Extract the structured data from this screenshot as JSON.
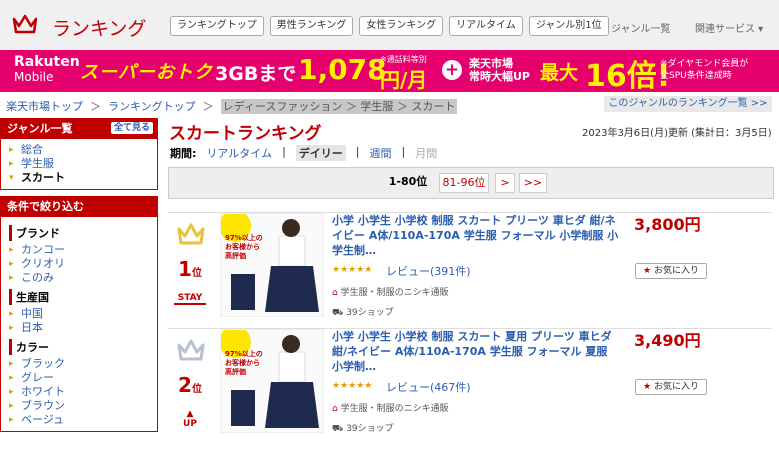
{
  "header": {
    "title": "ランキング",
    "tabs": [
      "ランキングトップ",
      "男性ランキング",
      "女性ランキング",
      "リアルタイム",
      "ジャンル別1位"
    ],
    "genre_list": "ジャンル一覧",
    "related": "関連サービス ▾"
  },
  "banner": {
    "brand": "Rakuten",
    "brand2": "Mobile",
    "super": "スーパーおトク",
    "gb": "3GBまで",
    "price": "1,078",
    "note": "※通話料等別",
    "unit": "円/月",
    "plus": "+",
    "ichiba1": "楽天市場",
    "ichiba2": "常時大幅UP",
    "max": "最大",
    "bai": "16倍!",
    "dia1": "※ダイヤモンド会員が",
    "dia2": "全SPU条件達成時"
  },
  "breadcrumb": {
    "items": [
      "楽天市場トップ",
      "ランキングトップ"
    ],
    "current": "レディースファッション ＞ 学生服 ＞ スカート",
    "sep": "＞",
    "right_link": "このジャンルのランキング一覧 >>"
  },
  "sidebar": {
    "genre_title": "ジャンル一覧",
    "see_all": "全て見る",
    "genres": [
      "総合",
      "学生服",
      "スカート"
    ],
    "filter_title": "条件で絞り込む",
    "brand_title": "ブランド",
    "brands": [
      "カンコー",
      "クリオリ",
      "このみ"
    ],
    "origin_title": "生産国",
    "origins": [
      "中国",
      "日本"
    ],
    "color_title": "カラー",
    "colors": [
      "ブラック",
      "グレー",
      "ホワイト",
      "ブラウン",
      "ベージュ"
    ]
  },
  "main": {
    "title": "スカートランキング",
    "date": "2023年3月6日(月)更新 (集計日：3月5日)",
    "period_label": "期間:",
    "periods": [
      "リアルタイム",
      "デイリー",
      "週間",
      "月間"
    ],
    "pager": [
      "1-80位",
      "81-96位",
      ">",
      ">>"
    ]
  },
  "items": [
    {
      "rank": "1",
      "rank_suffix": "位",
      "trend": "STAY",
      "name": "小学 小学生 小学校 制服 スカート プリーツ 車ヒダ 紺/ネイビー A体/110A-170A 学生服 フォーマル 小学制服 小学生制…",
      "stars": "★★★★★",
      "reviews": "レビュー(391件)",
      "shop": "学生服・制服のニシキ通販",
      "shipping": "39ショップ",
      "price": "3,800円",
      "fav": "お気に入り",
      "img_badge": "97%以上の お客様から 高評価",
      "crown_color": "#e8c23a"
    },
    {
      "rank": "2",
      "rank_suffix": "位",
      "trend": "UP",
      "name": "小学 小学生 小学校 制服 スカート 夏用 プリーツ 車ヒダ 紺/ネイビー A体/110A-170A 学生服 フォーマル 夏服 小学制…",
      "stars": "★★★★★",
      "reviews": "レビュー(467件)",
      "shop": "学生服・制服のニシキ通販",
      "shipping": "39ショップ",
      "price": "3,490円",
      "fav": "お気に入り",
      "img_badge": "97%以上の お客様から 高評価",
      "crown_color": "#b9c2cc"
    }
  ]
}
